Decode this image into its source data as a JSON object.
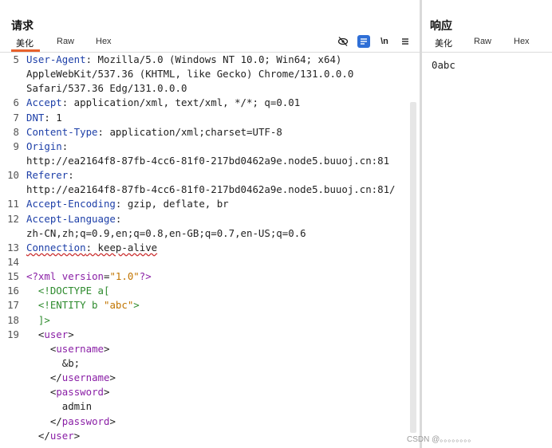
{
  "request": {
    "title": "请求",
    "tabs": [
      "美化",
      "Raw",
      "Hex"
    ],
    "toolbar": {
      "hide_icon": "eye-slash-icon",
      "wrap_icon": "wrap-lines-icon",
      "newline_label": "\\n",
      "menu_icon": "hamburger-menu-icon"
    },
    "line_numbers": [
      "5",
      "",
      "",
      "6",
      "7",
      "8",
      "9",
      "",
      "10",
      "",
      "11",
      "12",
      "",
      "13",
      "14",
      "15",
      "16",
      "17",
      "18",
      "19",
      "",
      "",
      "",
      "",
      "",
      "",
      ""
    ],
    "lines": [
      [
        {
          "c": "k",
          "t": "User-Agent"
        },
        {
          "c": "",
          "t": ": Mozilla/5.0 (Windows NT 10.0; Win64; x64)"
        }
      ],
      [
        {
          "c": "",
          "t": "AppleWebKit/537.36 (KHTML, like Gecko) Chrome/131.0.0.0"
        }
      ],
      [
        {
          "c": "",
          "t": "Safari/537.36 Edg/131.0.0.0"
        }
      ],
      [
        {
          "c": "k",
          "t": "Accept"
        },
        {
          "c": "",
          "t": ": application/xml, text/xml, */*; q=0.01"
        }
      ],
      [
        {
          "c": "k",
          "t": "DNT"
        },
        {
          "c": "",
          "t": ": 1"
        }
      ],
      [
        {
          "c": "k",
          "t": "Content-Type"
        },
        {
          "c": "",
          "t": ": application/xml;charset=UTF-8"
        }
      ],
      [
        {
          "c": "k",
          "t": "Origin"
        },
        {
          "c": "",
          "t": ":"
        }
      ],
      [
        {
          "c": "",
          "t": "http://ea2164f8-87fb-4cc6-81f0-217bd0462a9e.node5.buuoj.cn:81"
        }
      ],
      [
        {
          "c": "k",
          "t": "Referer"
        },
        {
          "c": "",
          "t": ":"
        }
      ],
      [
        {
          "c": "",
          "t": "http://ea2164f8-87fb-4cc6-81f0-217bd0462a9e.node5.buuoj.cn:81/"
        }
      ],
      [
        {
          "c": "k",
          "t": "Accept-Encoding"
        },
        {
          "c": "",
          "t": ": gzip, deflate, br"
        }
      ],
      [
        {
          "c": "k",
          "t": "Accept-Language"
        },
        {
          "c": "",
          "t": ":"
        }
      ],
      [
        {
          "c": "",
          "t": "zh-CN,zh;q=0.9,en;q=0.8,en-GB;q=0.7,en-US;q=0.6"
        }
      ],
      [
        {
          "c": "k squiggle",
          "t": "Connection"
        },
        {
          "c": "squiggle",
          "t": ": keep-alive"
        }
      ],
      [
        {
          "c": "",
          "t": ""
        }
      ],
      [
        {
          "c": "pi",
          "t": "<?xml "
        },
        {
          "c": "attr",
          "t": "version"
        },
        {
          "c": "",
          "t": "="
        },
        {
          "c": "str",
          "t": "\"1.0\""
        },
        {
          "c": "pi",
          "t": "?>"
        }
      ],
      [
        {
          "c": "dtd",
          "t": "  <!DOCTYPE a["
        }
      ],
      [
        {
          "c": "dtd",
          "t": "  <!ENTITY b "
        },
        {
          "c": "str",
          "t": "\"abc\""
        },
        {
          "c": "dtd",
          "t": ">"
        }
      ],
      [
        {
          "c": "dtd",
          "t": "  ]>"
        }
      ],
      [
        {
          "c": "",
          "t": "  <"
        },
        {
          "c": "tagc",
          "t": "user"
        },
        {
          "c": "",
          "t": ">"
        }
      ],
      [
        {
          "c": "",
          "t": "    <"
        },
        {
          "c": "tagc",
          "t": "username"
        },
        {
          "c": "",
          "t": ">"
        }
      ],
      [
        {
          "c": "",
          "t": "      &b;"
        }
      ],
      [
        {
          "c": "",
          "t": "    </"
        },
        {
          "c": "tagc",
          "t": "username"
        },
        {
          "c": "",
          "t": ">"
        }
      ],
      [
        {
          "c": "",
          "t": "    <"
        },
        {
          "c": "tagc",
          "t": "password"
        },
        {
          "c": "",
          "t": ">"
        }
      ],
      [
        {
          "c": "",
          "t": "      admin"
        }
      ],
      [
        {
          "c": "",
          "t": "    </"
        },
        {
          "c": "tagc",
          "t": "password"
        },
        {
          "c": "",
          "t": ">"
        }
      ],
      [
        {
          "c": "",
          "t": "  </"
        },
        {
          "c": "tagc",
          "t": "user"
        },
        {
          "c": "",
          "t": ">"
        }
      ]
    ]
  },
  "response": {
    "title": "响应",
    "tabs": [
      "美化",
      "Raw",
      "Hex"
    ],
    "body": "0abc"
  },
  "watermark": "CSDN @。。。。。。。。",
  "colors": {
    "accent": "#e8612c",
    "toolbar_active": "#2f6fd6",
    "header_key": "#1d3fa8",
    "xml_tag": "#8a1fa6",
    "string": "#c27500"
  }
}
